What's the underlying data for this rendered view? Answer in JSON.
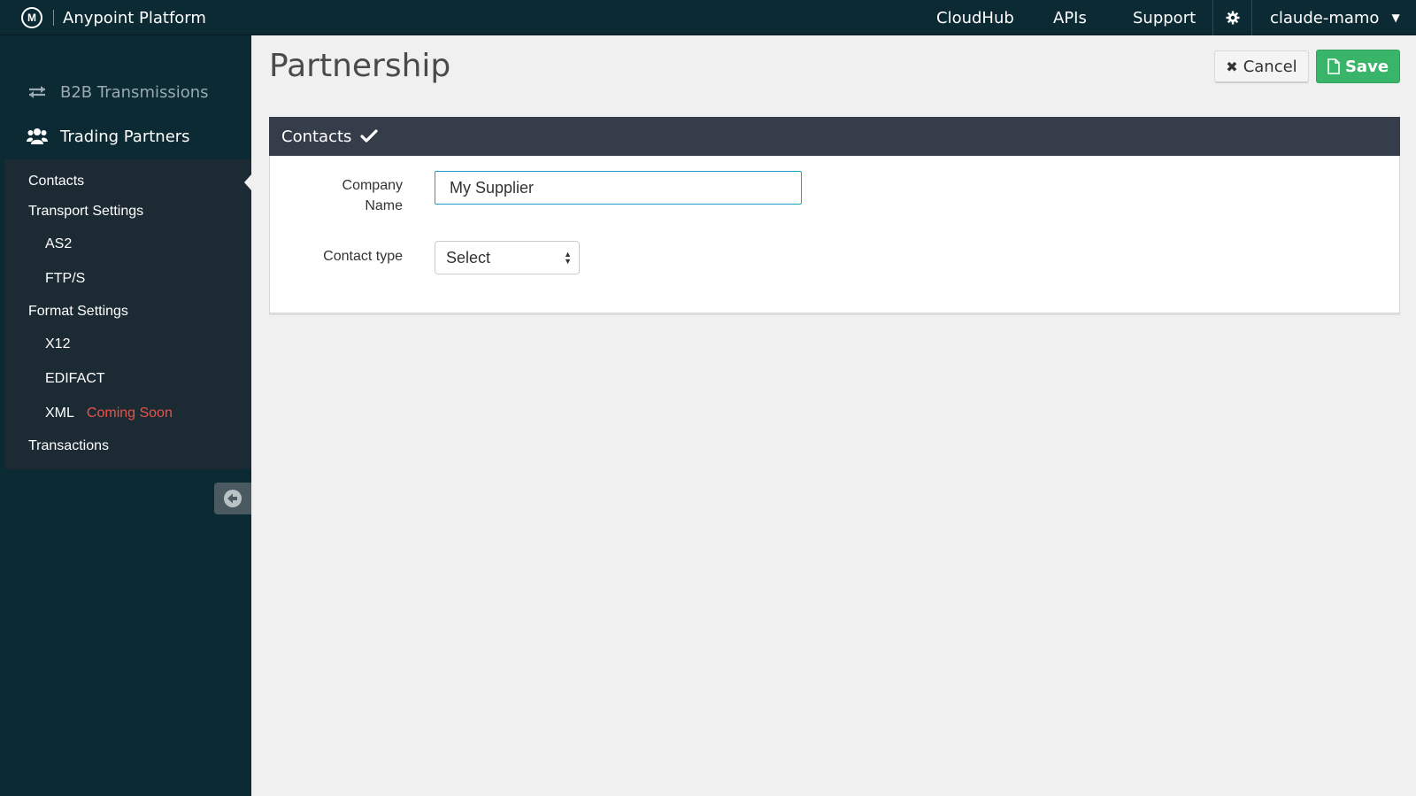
{
  "header": {
    "logo_letter": "M",
    "brand": "Anypoint Platform",
    "nav": {
      "cloudhub": "CloudHub",
      "apis": "APIs",
      "support": "Support"
    },
    "user": "claude-mamo",
    "user_caret": "▼"
  },
  "sidebar": {
    "b2b": "B2B Transmissions",
    "trading_partners": "Trading Partners",
    "subnav": {
      "contacts": "Contacts",
      "transport_settings": "Transport Settings",
      "as2": "AS2",
      "ftps": "FTP/S",
      "format_settings": "Format Settings",
      "x12": "X12",
      "edifact": "EDIFACT",
      "xml": "XML",
      "coming_soon": "Coming Soon",
      "transactions": "Transactions"
    }
  },
  "page": {
    "title": "Partnership",
    "cancel": "Cancel",
    "save": "Save"
  },
  "panel": {
    "title": "Contacts",
    "company_name_label_1": "Company",
    "company_name_label_2": "Name",
    "company_name_value": "My Supplier",
    "contact_type_label": "Contact type",
    "contact_type_value": "Select"
  },
  "colors": {
    "topbar": "#0b2a33",
    "subnav": "#1c2b33",
    "panel_header": "#363d4a",
    "save": "#39b56a",
    "coming_soon": "#e8524a",
    "input_focus": "#1ea0c8"
  },
  "icons": {
    "logo": "mulesoft-logo-icon",
    "gear": "gear-icon",
    "b2b": "transfer-arrows-icon",
    "trading_partners": "users-icon",
    "collapse": "arrow-left-circle-icon",
    "cancel": "close-icon",
    "save": "document-icon",
    "check": "checkmark-icon",
    "select": "sort-arrows-icon"
  }
}
